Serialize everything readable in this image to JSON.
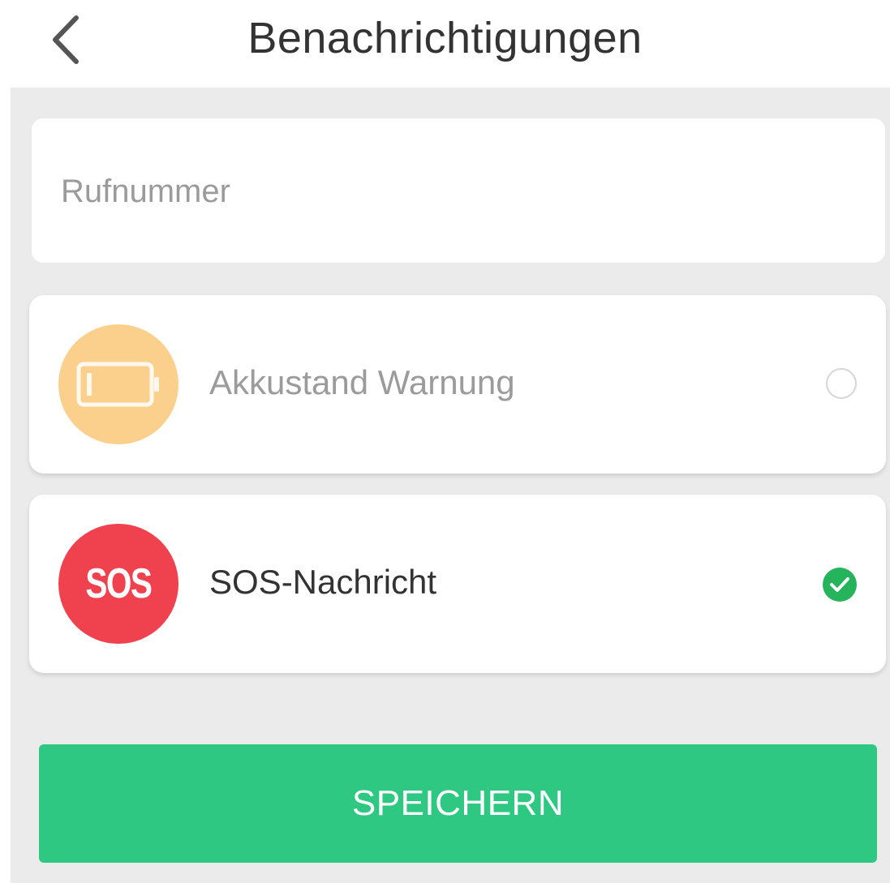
{
  "header": {
    "title": "Benachrichtigungen",
    "back_icon": "chevron-left-icon"
  },
  "phone": {
    "placeholder": "Rufnummer",
    "value": ""
  },
  "options": [
    {
      "label": "Akkustand Warnung",
      "icon": "battery-icon",
      "icon_color": "#fbd08c",
      "selected": false
    },
    {
      "label": "SOS-Nachricht",
      "icon": "sos-icon",
      "icon_text": "SOS",
      "icon_color": "#f0424e",
      "selected": true
    }
  ],
  "save_button": {
    "label": "SPEICHERN",
    "color": "#2ec883"
  },
  "colors": {
    "background": "#ebebeb",
    "check": "#25b35b"
  }
}
